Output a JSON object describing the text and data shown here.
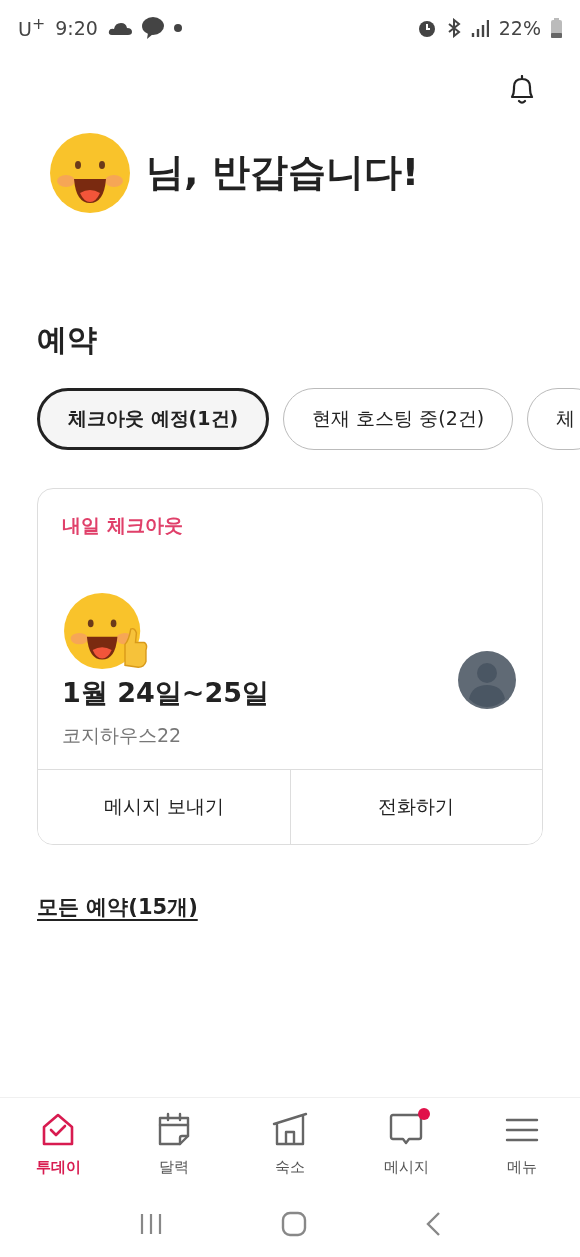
{
  "status_bar": {
    "carrier": "U$^{+}$",
    "time": "9:20",
    "battery": "22%"
  },
  "greeting": {
    "text": "님, 반갑습니다!"
  },
  "reservations": {
    "title": "예약",
    "tabs": [
      {
        "label": "체크아웃 예정(1건)",
        "selected": true
      },
      {
        "label": "현재 호스팅 중(2건)",
        "selected": false
      },
      {
        "label": "체",
        "selected": false
      }
    ],
    "card": {
      "tag": "내일 체크아웃",
      "dates": "1월 24일~25일",
      "listing": "코지하우스22",
      "actions": [
        "메시지 보내기",
        "전화하기"
      ]
    },
    "all_link": "모든 예약(15개)"
  },
  "bottom_nav": [
    {
      "label": "투데이",
      "kind": "today",
      "selected": true,
      "badge": false
    },
    {
      "label": "달력",
      "kind": "calendar",
      "selected": false,
      "badge": false
    },
    {
      "label": "숙소",
      "kind": "house",
      "selected": false,
      "badge": false
    },
    {
      "label": "메시지",
      "kind": "message",
      "selected": false,
      "badge": true
    },
    {
      "label": "메뉴",
      "kind": "menu",
      "selected": false,
      "badge": false
    }
  ]
}
